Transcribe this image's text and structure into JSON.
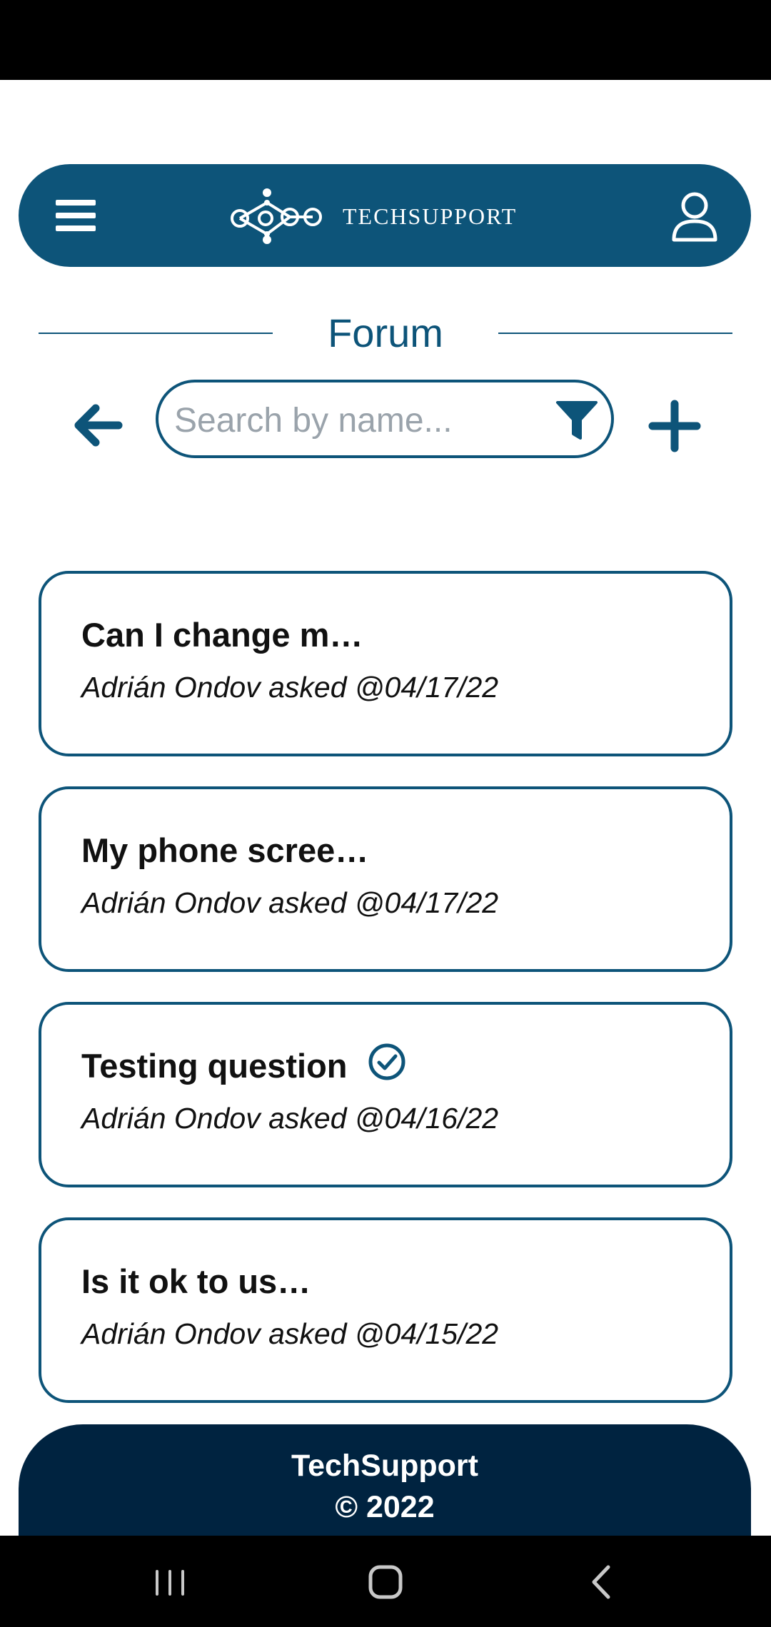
{
  "header": {
    "brand_name": "TECHSUPPORT",
    "colors": {
      "primary": "#0d5479",
      "footer": "#002340"
    },
    "icons": {
      "menu": "hamburger-menu-icon",
      "logo": "gears-logo-icon",
      "user": "user-profile-icon"
    }
  },
  "forum": {
    "title": "Forum",
    "search_placeholder": "Search by name...",
    "icons": {
      "back": "arrow-left-icon",
      "filter": "filter-funnel-icon",
      "add": "plus-icon"
    }
  },
  "questions": [
    {
      "title": "Can I change m…",
      "meta": "Adrián Ondov asked @04/17/22",
      "solved": false
    },
    {
      "title": "My phone scree…",
      "meta": "Adrián Ondov asked @04/17/22",
      "solved": false
    },
    {
      "title": "Testing question",
      "meta": "Adrián Ondov asked @04/16/22",
      "solved": true
    },
    {
      "title": "Is it ok to us…",
      "meta": "Adrián Ondov asked @04/15/22",
      "solved": false
    }
  ],
  "footer": {
    "line1": "TechSupport",
    "line2": "© 2022"
  },
  "system_nav": {
    "icons": [
      "recent-apps-icon",
      "home-icon",
      "back-icon"
    ]
  }
}
